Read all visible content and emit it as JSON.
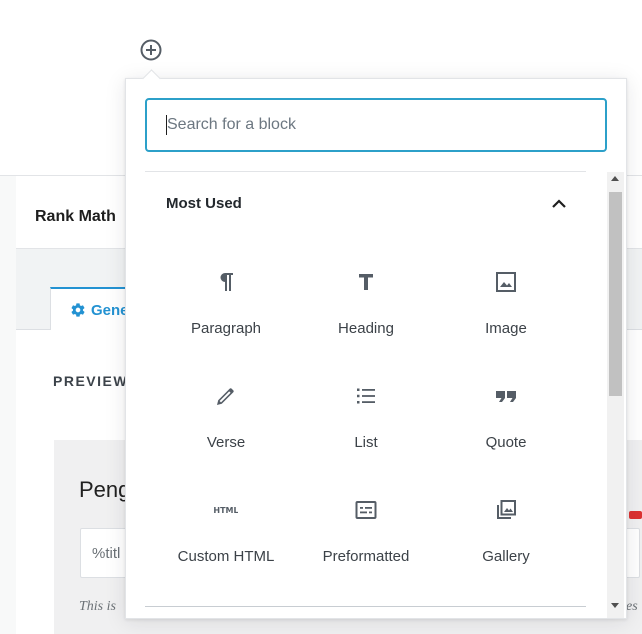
{
  "background": {
    "rank_math_title": "Rank Math",
    "tab_label": "Gene",
    "preview_label": "PREVIEW",
    "card_title": "Peng",
    "input_text": "%titl",
    "note_text": "This is",
    "note_text_right": "es"
  },
  "inserter": {
    "search": {
      "placeholder": "Search for a block",
      "value": ""
    },
    "panel": {
      "title": "Most Used",
      "blocks": [
        {
          "label": "Paragraph",
          "icon": "paragraph-icon"
        },
        {
          "label": "Heading",
          "icon": "heading-icon"
        },
        {
          "label": "Image",
          "icon": "image-icon"
        },
        {
          "label": "Verse",
          "icon": "pencil-icon"
        },
        {
          "label": "List",
          "icon": "list-icon"
        },
        {
          "label": "Quote",
          "icon": "quote-icon"
        },
        {
          "label": "Custom HTML",
          "icon": "html-icon"
        },
        {
          "label": "Preformatted",
          "icon": "preformatted-icon"
        },
        {
          "label": "Gallery",
          "icon": "gallery-icon"
        }
      ]
    }
  },
  "colors": {
    "accent": "#2ca0c9",
    "icon": "#555d66",
    "rank_math_blue": "#2392d2"
  }
}
